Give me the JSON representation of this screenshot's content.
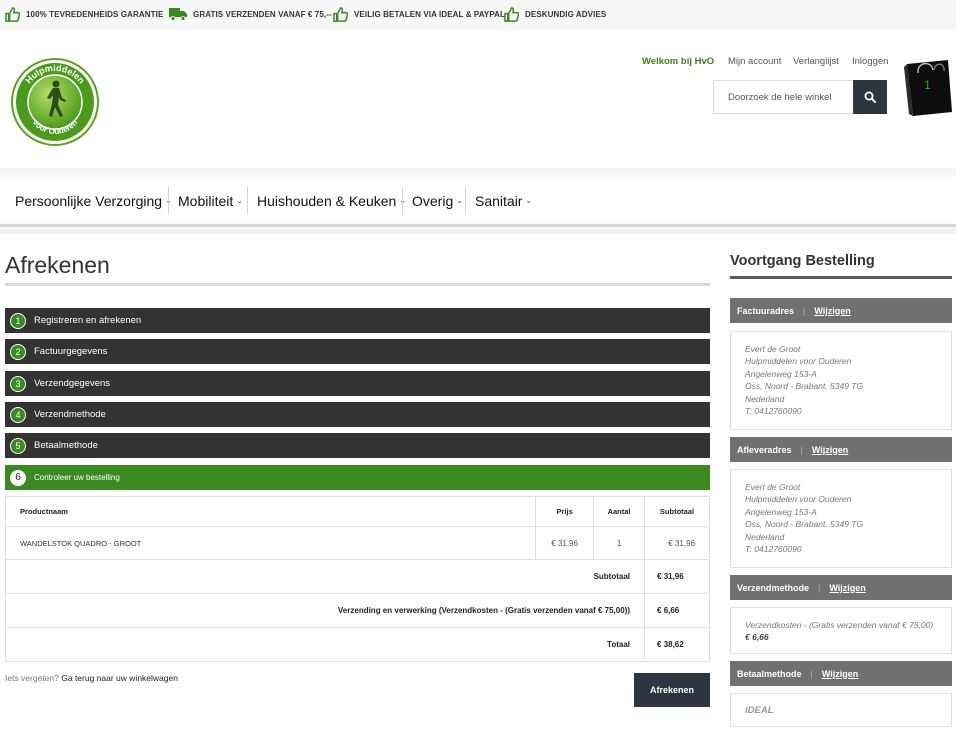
{
  "usp_bar": {
    "items": [
      "100% TEVREDENHEIDS GARANTIE",
      "GRATIS VERZENDEN VANAF € 75,--",
      "VEILIG BETALEN VIA IDEAL & PAYPAL",
      "DESKUNDIG ADVIES"
    ]
  },
  "header": {
    "logo_text_top": "Hulpmiddelen",
    "logo_text_bottom": "voor Ouderen",
    "welcome": "Welkom bij HvO",
    "links": [
      "Mijn account",
      "Verlanglijst",
      "Inloggen"
    ],
    "search_placeholder": "Doorzoek de hele winkel",
    "cart_count": "1"
  },
  "nav": {
    "items": [
      "Persoonlijke Verzorging",
      "Mobiliteit",
      "Huishouden & Keuken",
      "Overig",
      "Sanitair"
    ]
  },
  "checkout": {
    "title": "Afrekenen",
    "steps": [
      {
        "num": "1",
        "label": "Registreren en afrekenen"
      },
      {
        "num": "2",
        "label": "Factuurgegevens"
      },
      {
        "num": "3",
        "label": "Verzendgegevens"
      },
      {
        "num": "4",
        "label": "Verzendmethode"
      },
      {
        "num": "5",
        "label": "Betaalmethode"
      },
      {
        "num": "6",
        "label": "Controleer uw bestelling"
      }
    ],
    "table": {
      "headers": [
        "Productnaam",
        "Prijs",
        "Aantal",
        "Subtotaal"
      ],
      "rows": [
        {
          "name": "WANDELSTOK QUADRO - GROOT",
          "price": "€ 31,96",
          "qty": "1",
          "subtotal": "€ 31,96"
        }
      ],
      "totals": [
        {
          "label": "Subtotaal",
          "value": "€ 31,96"
        },
        {
          "label": "Verzending en verwerking (Verzendkosten - (Gratis verzenden vanaf € 75,00))",
          "value": "€ 6,66"
        },
        {
          "label": "Totaal",
          "value": "€ 38,62"
        }
      ]
    },
    "forgot_text": "Iets vergeten?",
    "forgot_link": "Ga terug naar uw winkelwagen",
    "submit_label": "Afrekenen"
  },
  "sidebar": {
    "title": "Voortgang Bestelling",
    "billing": {
      "label": "Factuuradres",
      "edit": "Wijzigen",
      "lines": [
        "Evert de Groot",
        "Hulpmiddelen voor Ouderen",
        "Angelenweg 153-A",
        "Oss, Noord - Brabant, 5349 TG",
        "Nederland",
        "T: 0412760090"
      ]
    },
    "shipping": {
      "label": "Afleveradres",
      "edit": "Wijzigen",
      "lines": [
        "Evert de Groot",
        "Hulpmiddelen voor Ouderen",
        "Angelenweg 153-A",
        "Oss, Noord - Brabant, 5349 TG",
        "Nederland",
        "T: 0412760090"
      ]
    },
    "method": {
      "label": "Verzendmethode",
      "edit": "Wijzigen",
      "text": "Verzendkosten - (Gratis verzenden vanaf € 75,00)",
      "amount": "€ 6,66"
    },
    "payment": {
      "label": "Betaalmethode",
      "edit": "Wijzigen",
      "text": "iDEAL"
    }
  },
  "colors": {
    "brand_green": "#3a8a21",
    "dark": "#333333",
    "button_dark": "#2c3540",
    "sidebar_head": "#707070"
  }
}
